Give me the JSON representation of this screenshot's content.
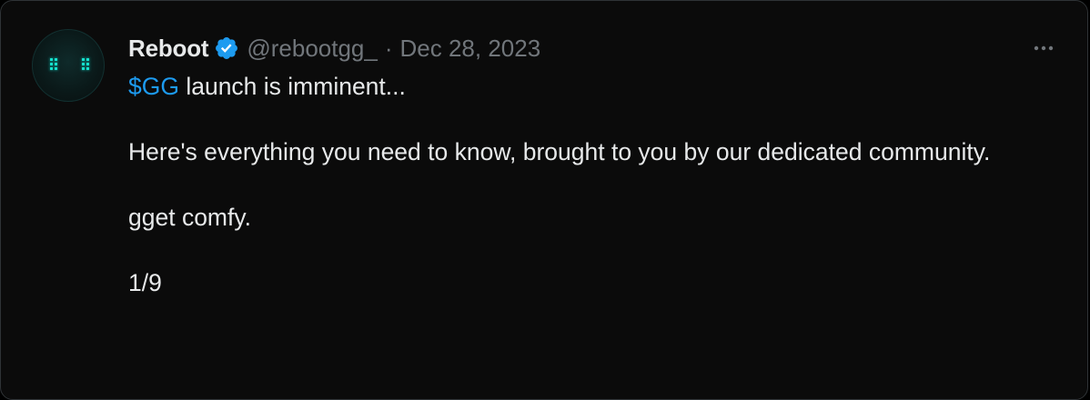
{
  "tweet": {
    "author": {
      "name": "Reboot",
      "handle": "@rebootgg_",
      "verified_color": "#1d9bf0",
      "avatar_accent": "#16e3cf"
    },
    "separator": "·",
    "date": "Dec 28, 2023",
    "more_icon": "more-horizontal-icon",
    "text": {
      "cashtag": "$GG",
      "line1_rest": " launch is imminent...",
      "line2": "Here's everything you need to know, brought to you by our dedicated community.",
      "line3": "gget comfy.",
      "line4": "1/9"
    }
  }
}
